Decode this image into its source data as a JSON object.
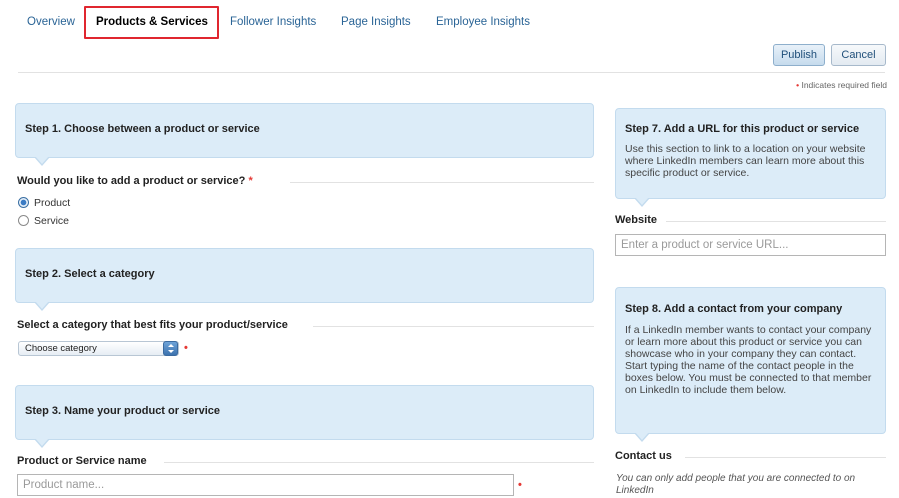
{
  "tabs": [
    {
      "label": "Overview",
      "active": false
    },
    {
      "label": "Products & Services",
      "active": true
    },
    {
      "label": "Follower Insights",
      "active": false
    },
    {
      "label": "Page Insights",
      "active": false
    },
    {
      "label": "Employee Insights",
      "active": false
    }
  ],
  "actions": {
    "publish_label": "Publish",
    "cancel_label": "Cancel"
  },
  "required_note": {
    "marker": "•",
    "text": "Indicates required field"
  },
  "left": {
    "step1": {
      "title": "Step 1. Choose between a product or service"
    },
    "type_question": {
      "label": "Would you like to add a product or service?",
      "required_marker": "*"
    },
    "type_options": [
      {
        "label": "Product",
        "selected": true
      },
      {
        "label": "Service",
        "selected": false
      }
    ],
    "step2": {
      "title": "Step 2. Select a category"
    },
    "category": {
      "label": "Select a category that best fits your product/service",
      "selected_value": "Choose category",
      "required_marker": "•"
    },
    "step3": {
      "title": "Step 3. Name your product or service"
    },
    "name_field": {
      "label": "Product or Service name",
      "placeholder": "Product name...",
      "value": "",
      "required_marker": "•"
    }
  },
  "right": {
    "step7": {
      "title": "Step 7. Add a URL for this product or service",
      "description": "Use this section to link to a location on your website where LinkedIn members can learn more about this specific product or service."
    },
    "website": {
      "label": "Website",
      "placeholder": "Enter a product or service URL...",
      "value": ""
    },
    "step8": {
      "title": "Step 8. Add a contact from your company",
      "description": "If a LinkedIn member wants to contact your company or learn more about this product or service you can showcase who in your company they can contact. Start typing the name of the contact people in the boxes below. You must be connected to that member on LinkedIn to include them below."
    },
    "contact": {
      "label": "Contact us",
      "note": "You can only add people that you are connected to on LinkedIn"
    }
  },
  "colors": {
    "link": "#2a6496",
    "panel_bg": "#dcecf8",
    "panel_border": "#c3dbee",
    "required": "#e53935",
    "highlight_box": "#e0262f"
  }
}
